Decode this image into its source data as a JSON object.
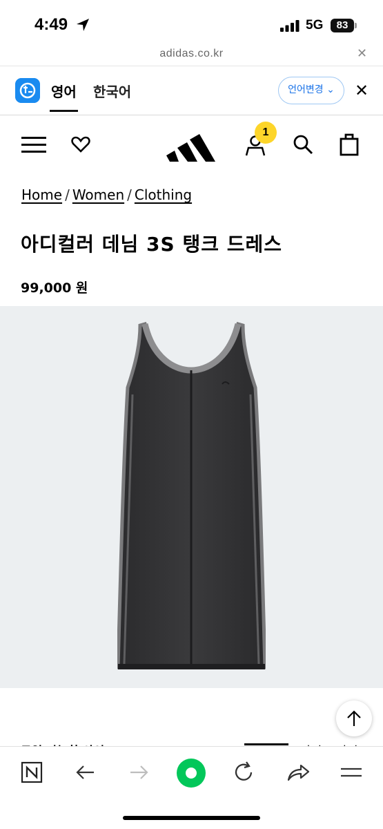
{
  "status_bar": {
    "time": "4:49",
    "network": "5G",
    "battery": "83"
  },
  "browser": {
    "url": "adidas.co.kr"
  },
  "translate_bar": {
    "tab_english": "영어",
    "tab_korean": "한국어",
    "change_language": "언어변경"
  },
  "header": {
    "cart_badge": "1"
  },
  "breadcrumb": {
    "home": "Home",
    "women": "Women",
    "clothing": "Clothing",
    "separator": "/"
  },
  "product": {
    "title": "아디컬러 데님 3S 탱크 드레스",
    "price": "99,000 원"
  },
  "below_image": {
    "available_sizes": "구입 가능한 사이즈",
    "size_guide": "사이즈 가이드"
  },
  "colors": {
    "accent_blue": "#1a8bf0",
    "badge_yellow": "#fdd52a",
    "reload_green": "#03c75a",
    "image_bg": "#eceff1"
  }
}
